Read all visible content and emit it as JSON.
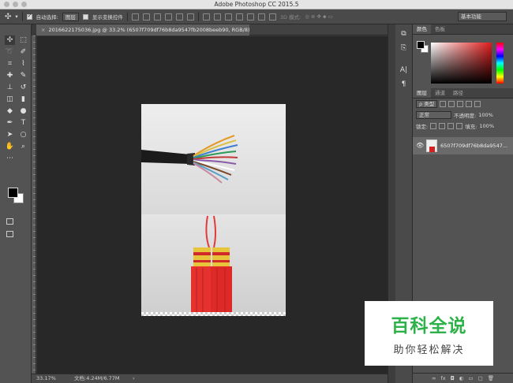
{
  "window": {
    "title": "Adobe Photoshop CC 2015.5"
  },
  "options_bar": {
    "auto_select_label": "自动选择:",
    "auto_select_value": "图层",
    "show_transform_label": "显示变换控件",
    "mode_3d_label": "3D 模式:",
    "workspace": "基本功能"
  },
  "document": {
    "tab_title": "20166221750​36.jpg @ 33.2% (6507f709df76b8da9547fb2008beeb90, RGB/8) *",
    "zoom": "33.17%",
    "doc_size": "文档:4.24M/6.77M"
  },
  "tools": [
    {
      "name": "move-tool",
      "glyph": "✣"
    },
    {
      "name": "marquee-tool",
      "glyph": "⬚"
    },
    {
      "name": "lasso-tool",
      "glyph": "➰"
    },
    {
      "name": "quick-select-tool",
      "glyph": "✐"
    },
    {
      "name": "crop-tool",
      "glyph": "⌗"
    },
    {
      "name": "eyedropper-tool",
      "glyph": "⌇"
    },
    {
      "name": "healing-tool",
      "glyph": "✚"
    },
    {
      "name": "brush-tool",
      "glyph": "✎"
    },
    {
      "name": "stamp-tool",
      "glyph": "⊥"
    },
    {
      "name": "history-brush-tool",
      "glyph": "↺"
    },
    {
      "name": "eraser-tool",
      "glyph": "◫"
    },
    {
      "name": "gradient-tool",
      "glyph": "▮"
    },
    {
      "name": "blur-tool",
      "glyph": "◆"
    },
    {
      "name": "dodge-tool",
      "glyph": "●"
    },
    {
      "name": "pen-tool",
      "glyph": "✒"
    },
    {
      "name": "type-tool",
      "glyph": "T"
    },
    {
      "name": "path-select-tool",
      "glyph": "➤"
    },
    {
      "name": "shape-tool",
      "glyph": "○"
    },
    {
      "name": "hand-tool",
      "glyph": "✋"
    },
    {
      "name": "zoom-tool",
      "glyph": "⌕"
    },
    {
      "name": "more-tools",
      "glyph": "⋯"
    },
    {
      "name": "blank",
      "glyph": ""
    }
  ],
  "color_panel": {
    "tab_color": "颜色",
    "tab_swatches": "色板"
  },
  "layers_panel": {
    "tab_layers": "图层",
    "tab_channels": "通道",
    "tab_paths": "路径",
    "filter_kind": "ρ 类型",
    "blend_mode": "正常",
    "opacity_label": "不透明度:",
    "opacity_value": "100%",
    "lock_label": "锁定:",
    "fill_label": "填充:",
    "fill_value": "100%",
    "layer_name": "6507f709df76b8da9547...",
    "footer_icons": [
      "∞",
      "fx",
      "◘",
      "◐",
      "▭",
      "▢",
      "🗑"
    ]
  },
  "watermark": {
    "title": "百科全说",
    "subtitle": "助你轻松解决"
  }
}
